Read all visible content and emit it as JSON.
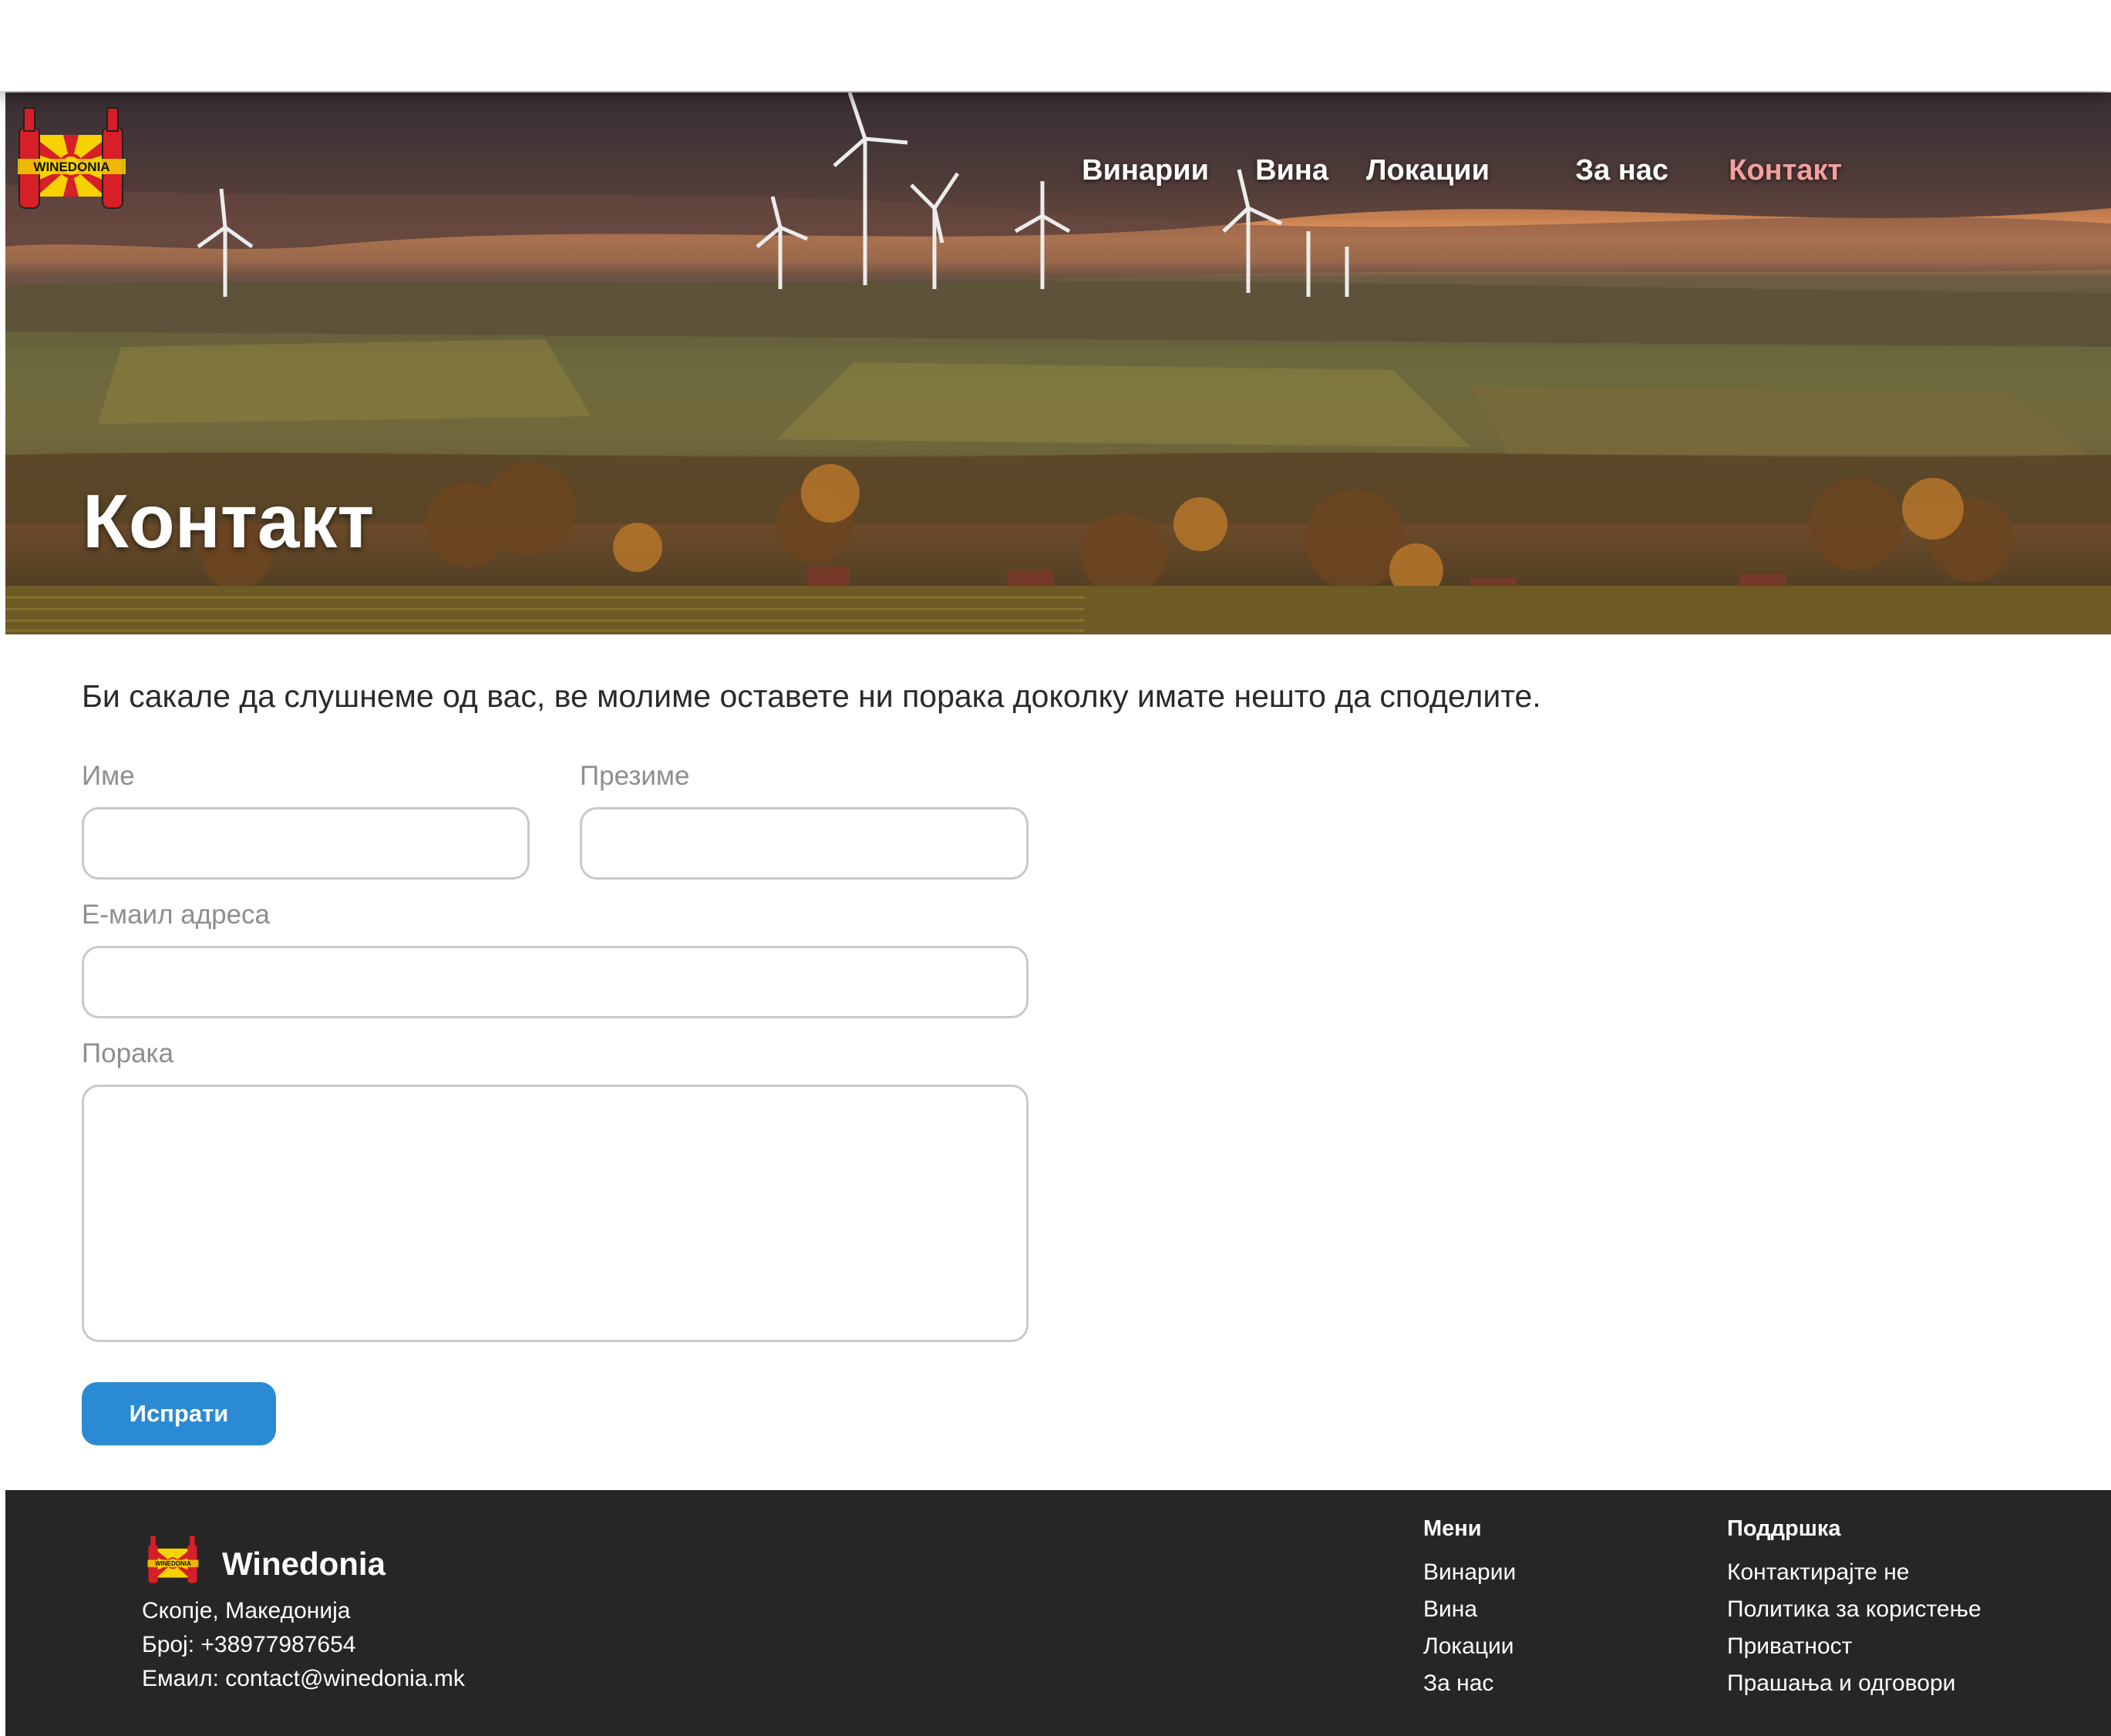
{
  "header": {
    "logo_text": "WINEDONIA",
    "nav": [
      {
        "label": "Винарии",
        "active": false
      },
      {
        "label": "Вина",
        "active": false
      },
      {
        "label": "Локации",
        "active": false
      },
      {
        "label": "За нас",
        "active": false
      },
      {
        "label": "Контакт",
        "active": true
      }
    ]
  },
  "hero": {
    "title": "Контакт"
  },
  "form": {
    "intro": "Би сакале да слушнеме од вас, ве молиме оставете ни порака доколку имате нешто да споделите.",
    "first_name_label": "Име",
    "first_name_value": "",
    "last_name_label": "Презиме",
    "last_name_value": "",
    "email_label": "Е-маил адреса",
    "email_value": "",
    "message_label": "Порака",
    "message_value": "",
    "submit_label": "Испрати"
  },
  "footer": {
    "brand": "Winedonia",
    "address": "Скопје, Македонија",
    "phone": "Број: +38977987654",
    "email": "Емаил: contact@winedonia.mk",
    "menu_title": "Мени",
    "menu_items": [
      "Винарии",
      "Вина",
      "Локации",
      "За нас"
    ],
    "support_title": "Поддршка",
    "support_items": [
      "Контактирајте не",
      "Политика за користење",
      "Приватност",
      "Прашања и одговори"
    ]
  },
  "colors": {
    "accent": "#2a8ad4",
    "nav_active": "#f4a0a0",
    "footer_bg": "#262626",
    "logo_red": "#d61f26",
    "logo_yellow": "#f6d200"
  }
}
